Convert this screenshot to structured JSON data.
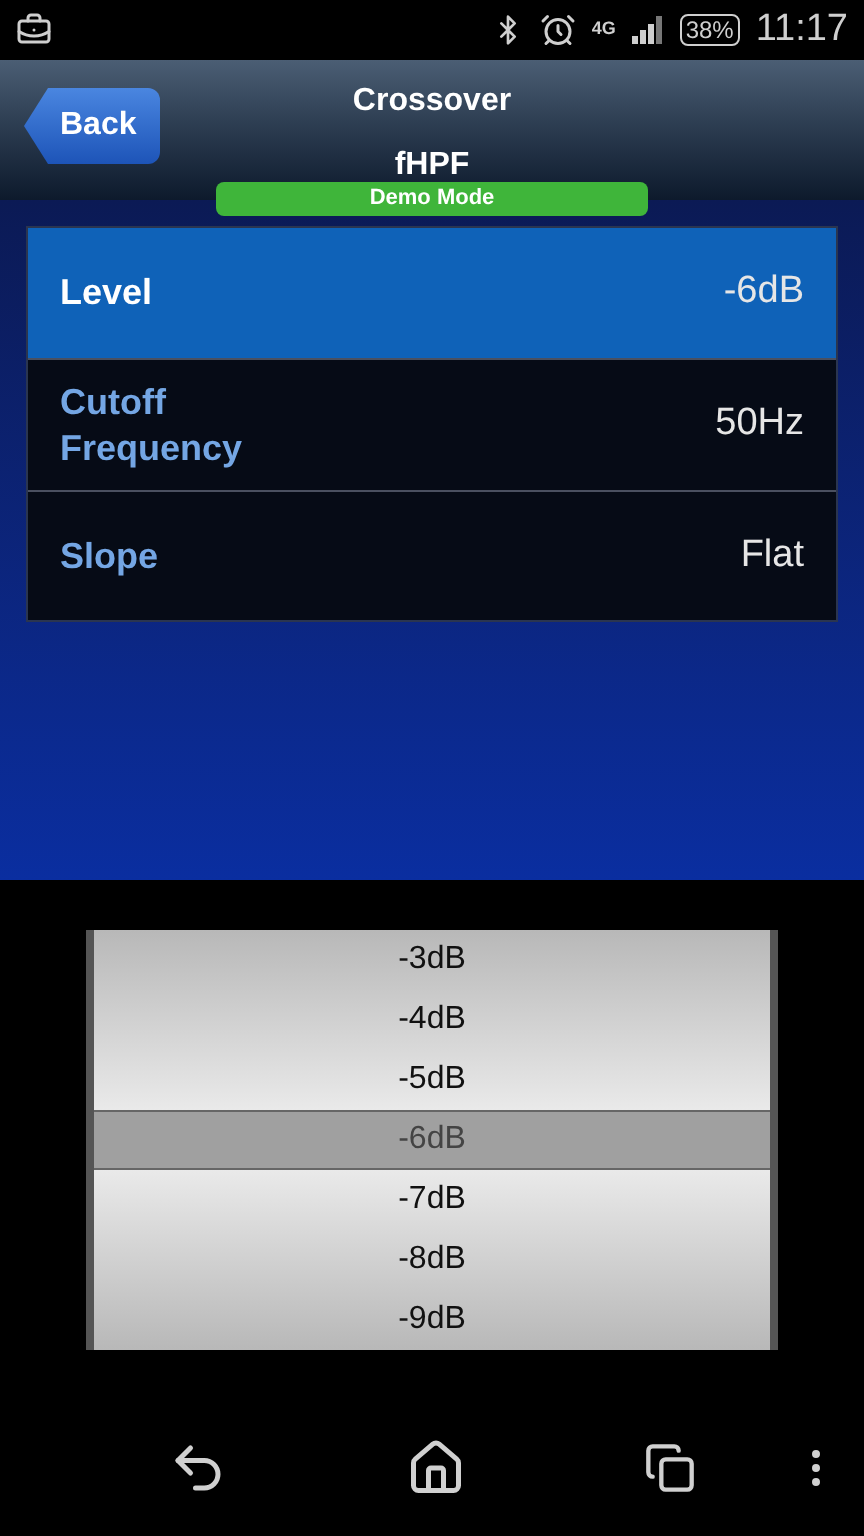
{
  "status_bar": {
    "network": "4G",
    "battery": "38%",
    "time": "11:17"
  },
  "header": {
    "back": "Back",
    "title": "Crossover",
    "subtitle": "fHPF",
    "mode_badge": "Demo Mode"
  },
  "settings": [
    {
      "label": "Level",
      "value": "-6dB",
      "selected": true
    },
    {
      "label": "Cutoff Frequency",
      "value": "50Hz",
      "selected": false
    },
    {
      "label": "Slope",
      "value": "Flat",
      "selected": false
    }
  ],
  "picker": [
    {
      "label": "-3dB",
      "selected": false
    },
    {
      "label": "-4dB",
      "selected": false
    },
    {
      "label": "-5dB",
      "selected": false
    },
    {
      "label": "-6dB",
      "selected": true
    },
    {
      "label": "-7dB",
      "selected": false
    },
    {
      "label": "-8dB",
      "selected": false
    },
    {
      "label": "-9dB",
      "selected": false
    }
  ]
}
